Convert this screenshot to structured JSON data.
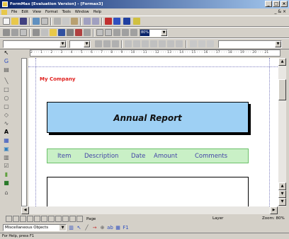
{
  "window": {
    "title": "FormMax [Evaluation Version] - [Formax3]",
    "controls": [
      "_",
      "□",
      "×"
    ]
  },
  "menu": {
    "items": [
      "File",
      "Edit",
      "View",
      "Format",
      "Tools",
      "Window",
      "Help"
    ],
    "right": "_ & ×"
  },
  "toolbar": {
    "zoom_value": "80%",
    "font_combo": "",
    "size_combo": ""
  },
  "ruler": {
    "numbers": "2 · · · 1 · · · 2 · · · 3 · · · 4 · · · 5 · · · 6 · · · 7 · · · 8 · · · 9 · · · 10 · · · 11 · · · 12 · · · 13 · · · 14 · · · 15 · · · 16 · · · 17 · · · 18 · · · 19 · · · 20 · · · 21"
  },
  "document": {
    "company": "My Company",
    "report_title": "Annual Report",
    "columns": [
      "Item",
      "Description",
      "Date",
      "Amount",
      "Comments"
    ]
  },
  "page_tabs": {
    "label": "Page"
  },
  "status": {
    "layer": "Layer",
    "zoom": "Zoom: 80%",
    "object_combo": "Miscellaneous Objects",
    "help": "For Help, press F1"
  },
  "colors": {
    "company_text": "#e0201e",
    "report_fill": "#9ed0f4",
    "column_band": "#c9f0c6",
    "column_text": "#4142a6",
    "title_bar": "#0a246a"
  }
}
